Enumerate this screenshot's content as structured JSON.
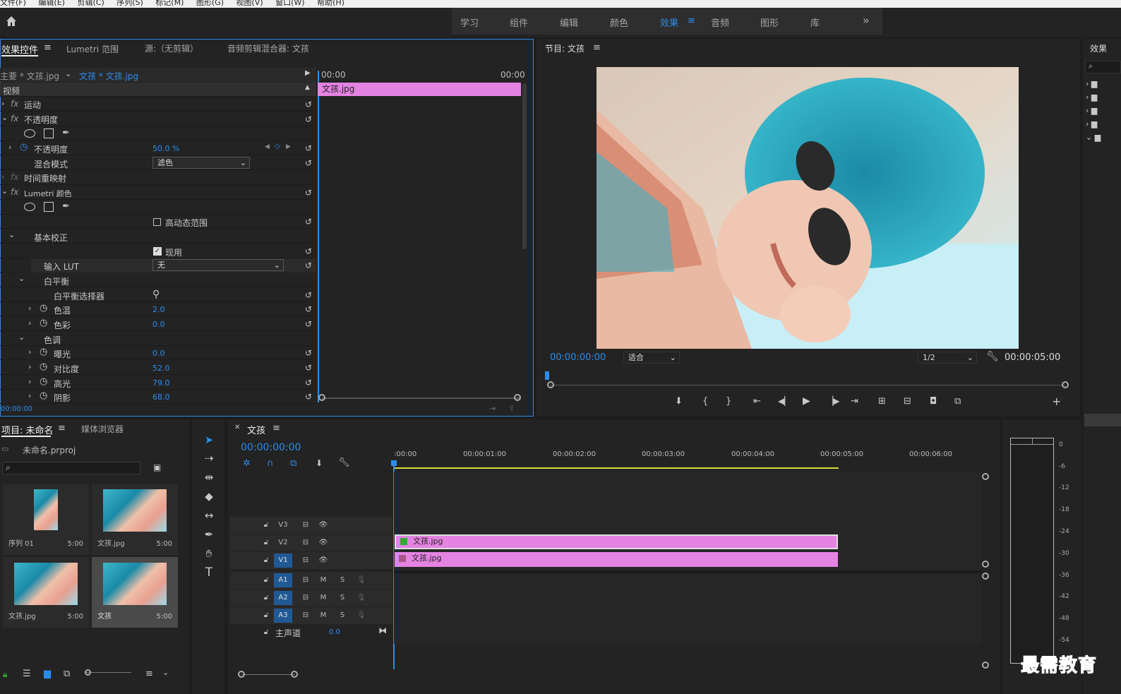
{
  "menu": [
    "文件(F)",
    "编辑(E)",
    "剪辑(C)",
    "序列(S)",
    "标记(M)",
    "图形(G)",
    "视图(V)",
    "窗口(W)",
    "帮助(H)"
  ],
  "workspaces": [
    "学习",
    "组件",
    "编辑",
    "颜色",
    "效果",
    "音频",
    "图形",
    "库"
  ],
  "active_workspace": "效果",
  "effect_panel": {
    "tabs": [
      "效果控件",
      "Lumetri 范围",
      "源:（无剪辑）",
      "音频剪辑混合器: 文孩"
    ],
    "master": "主要 * 文孩.jpg",
    "clip": "文孩 * 文孩.jpg",
    "time_start": "00:00",
    "time_end": "00:00",
    "clip_bar": "文孩.jpg",
    "section_video": "视频",
    "motion": "运动",
    "opacity_group": "不透明度",
    "opacity_label": "不透明度",
    "opacity_value": "50.0 %",
    "blend_label": "混合模式",
    "blend_value": "滤色",
    "time_remap": "时间重映射",
    "lumetri": "Lumetri 颜色",
    "hdr": "高动态范围",
    "basic": "基本校正",
    "use": "现用",
    "lut_label": "输入 LUT",
    "lut_value": "无",
    "wb": "白平衡",
    "wb_picker": "白平衡选择器",
    "temp_label": "色温",
    "temp_value": "2.0",
    "tint_label": "色彩",
    "tint_value": "0.0",
    "tone": "色调",
    "exposure_label": "曝光",
    "exposure_value": "0.0",
    "contrast_label": "对比度",
    "contrast_value": "52.0",
    "highlights_label": "高光",
    "highlights_value": "79.0",
    "shadows_label": "阴影",
    "shadows_value": "68.0",
    "footer_time": "00:00:00"
  },
  "program": {
    "title": "节目: 文孩",
    "timecode": "00:00:00:00",
    "fit": "适合",
    "quality": "1/2",
    "duration": "00:00:05:00"
  },
  "right_panel": {
    "title": "效果"
  },
  "project": {
    "tab": "项目: 未命名",
    "tab2": "媒体浏览器",
    "file": "未命名.prproj",
    "items": [
      {
        "label": "序列 01",
        "dur": "5:00"
      },
      {
        "label": "文孩.jpg",
        "dur": "5:00"
      },
      {
        "label": "文孩.jpg",
        "dur": "5:00"
      },
      {
        "label": "文孩",
        "dur": "5:00"
      }
    ]
  },
  "timeline": {
    "tab": "文孩",
    "timecode": "00:00:00:00",
    "ruler": [
      ":00:00",
      "00:00:01:00",
      "00:00:02:00",
      "00:00:03:00",
      "00:00:04:00",
      "00:00:05:00",
      "00:00:06:00"
    ],
    "tracks_v": [
      "V3",
      "V2",
      "V1"
    ],
    "tracks_a": [
      "A1",
      "A2",
      "A3"
    ],
    "master": "主声道",
    "master_value": "0.0",
    "clip_v2": "文孩.jpg",
    "clip_v1": "文孩.jpg",
    "m": "M",
    "s": "S"
  },
  "meter": {
    "ticks": [
      "0",
      "-6",
      "-12",
      "-18",
      "-24",
      "-30",
      "-36",
      "-42",
      "-48",
      "-54"
    ]
  },
  "watermark": "最需教育"
}
